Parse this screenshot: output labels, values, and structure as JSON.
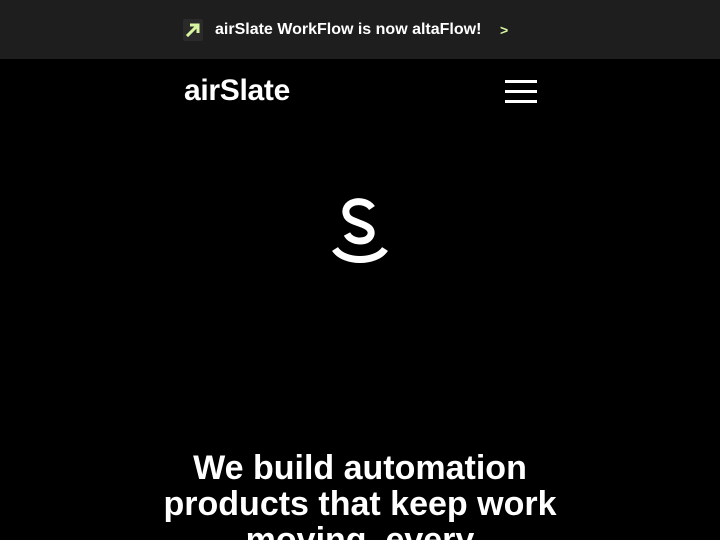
{
  "announcement": {
    "icon": "altaflow-arrow-icon",
    "text": "airSlate WorkFlow is now altaFlow!",
    "arrow": ">"
  },
  "header": {
    "logo_text": "airSlate",
    "menu_icon": "hamburger-menu-icon"
  },
  "hero": {
    "mark_icon": "airslate-s-mark-icon",
    "heading": "We build automation products that keep work moving, every"
  },
  "colors": {
    "background": "#000000",
    "banner_background": "#1e1e1e",
    "accent": "#d8f5a2",
    "text": "#ffffff"
  }
}
